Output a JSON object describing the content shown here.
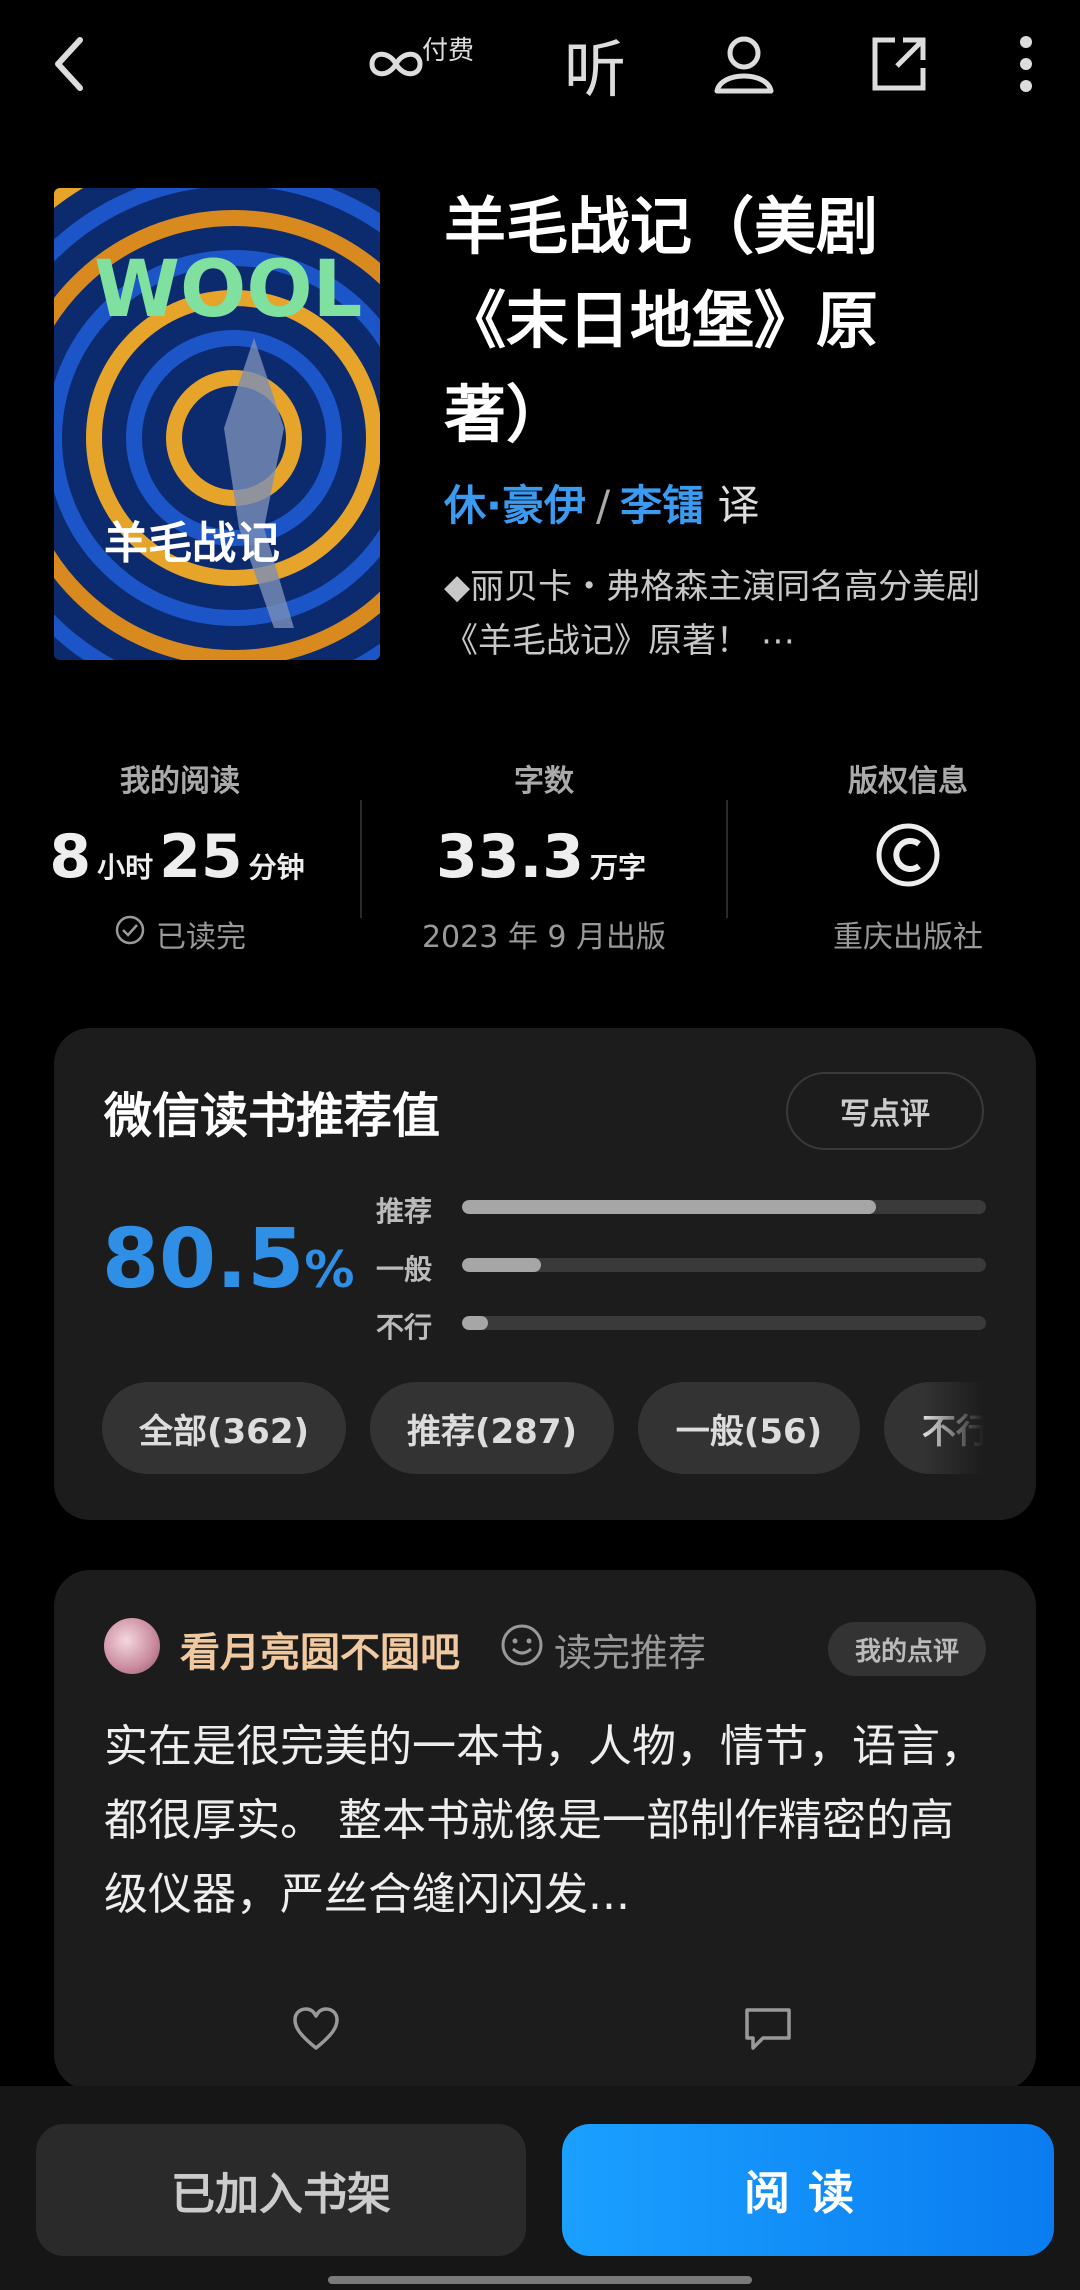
{
  "topbar": {
    "pay_label": "付费",
    "listen_label": "听"
  },
  "book": {
    "cover_title": "WOOL",
    "cover_cn": "羊毛战记",
    "title": "羊毛战记（美剧《末日地堡》原著）",
    "author": "休·豪伊",
    "separator": "/",
    "translator": "李镭",
    "translator_role": "译",
    "blurb": "◆丽贝卡・弗格森主演同名高分美剧《羊毛战记》原著！ ⋯"
  },
  "stats": {
    "reading": {
      "label": "我的阅读",
      "hours": "8",
      "hours_unit": "小时",
      "minutes": "25",
      "minutes_unit": "分钟",
      "status": "已读完"
    },
    "words": {
      "label": "字数",
      "count": "33.3",
      "unit": "万字",
      "published": "2023 年 9 月出版"
    },
    "copyright": {
      "label": "版权信息",
      "symbol": "©",
      "publisher": "重庆出版社"
    }
  },
  "recommend": {
    "title": "微信读书推荐值",
    "write_review": "写点评",
    "score": "80.5",
    "score_unit": "%",
    "bars": [
      {
        "label": "推荐",
        "fraction": 0.79
      },
      {
        "label": "一般",
        "fraction": 0.15
      },
      {
        "label": "不行",
        "fraction": 0.05
      }
    ],
    "filters": [
      "全部(362)",
      "推荐(287)",
      "一般(56)",
      "不行"
    ]
  },
  "review": {
    "reviewer": "看月亮圆不圆吧",
    "badge": "读完推荐",
    "my_review": "我的点评",
    "text": "实在是很完美的一本书，人物，情节，语言，都很厚实。 整本书就像是一部制作精密的高级仪器，严丝合缝闪闪发..."
  },
  "bottom": {
    "shelf_label": "已加入书架",
    "read_label": "阅读"
  },
  "colors": {
    "accent": "#2f8fe6",
    "read_button": "#0a8cf8",
    "reviewer_name": "#f0c9a0"
  }
}
